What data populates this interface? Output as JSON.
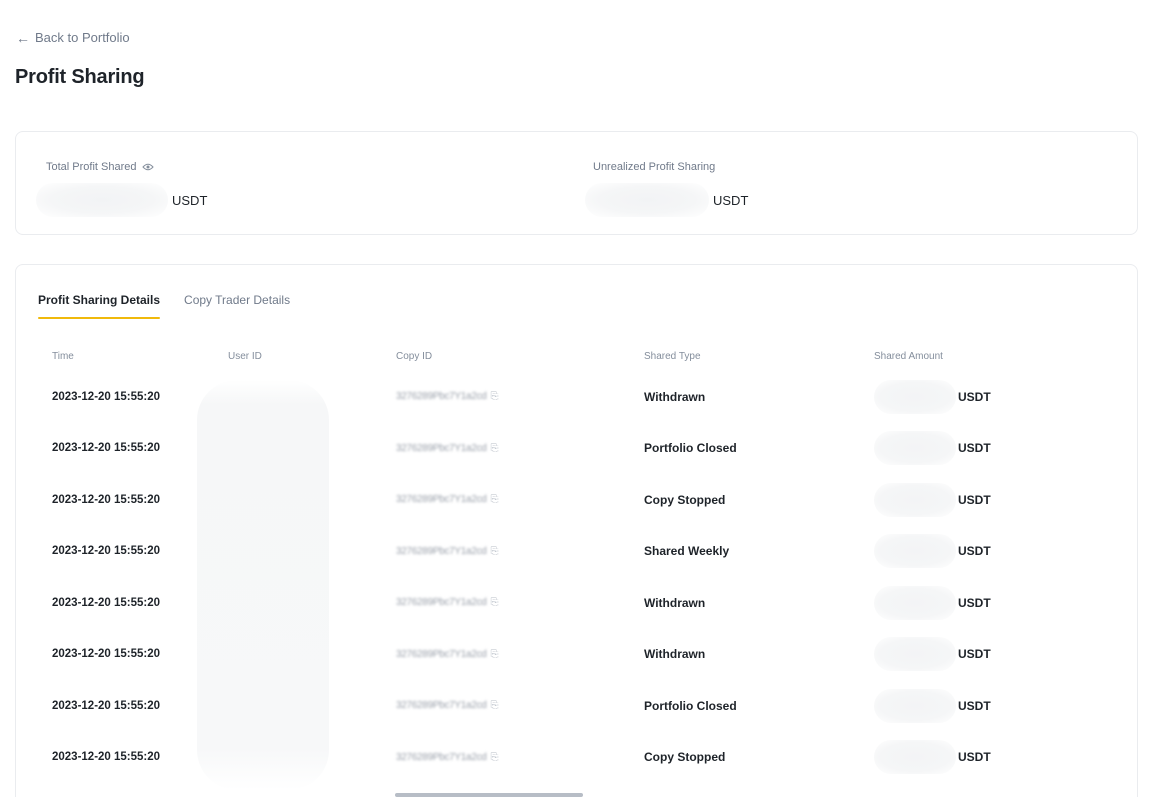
{
  "nav": {
    "back_label": "Back to Portfolio"
  },
  "page": {
    "title": "Profit Sharing"
  },
  "summary": {
    "total_label": "Total Profit Shared",
    "total_unit": "USDT",
    "unrealized_label": "Unrealized Profit Sharing",
    "unrealized_unit": "USDT"
  },
  "tabs": [
    {
      "label": "Profit Sharing Details",
      "active": true
    },
    {
      "label": "Copy Trader Details",
      "active": false
    }
  ],
  "table": {
    "headers": {
      "time": "Time",
      "user_id": "User ID",
      "copy_id": "Copy ID",
      "shared_type": "Shared Type",
      "shared_amount": "Shared Amount"
    },
    "rows": [
      {
        "time": "2023-12-20 15:55:20",
        "copy_id": "3276289Pbc7Y1a2cd",
        "shared_type": "Withdrawn",
        "unit": "USDT"
      },
      {
        "time": "2023-12-20 15:55:20",
        "copy_id": "3276289Pbc7Y1a2cd",
        "shared_type": "Portfolio Closed",
        "unit": "USDT"
      },
      {
        "time": "2023-12-20 15:55:20",
        "copy_id": "3276289Pbc7Y1a2cd",
        "shared_type": "Copy Stopped",
        "unit": "USDT"
      },
      {
        "time": "2023-12-20 15:55:20",
        "copy_id": "3276289Pbc7Y1a2cd",
        "shared_type": "Shared Weekly",
        "unit": "USDT"
      },
      {
        "time": "2023-12-20 15:55:20",
        "copy_id": "3276289Pbc7Y1a2cd",
        "shared_type": "Withdrawn",
        "unit": "USDT"
      },
      {
        "time": "2023-12-20 15:55:20",
        "copy_id": "3276289Pbc7Y1a2cd",
        "shared_type": "Withdrawn",
        "unit": "USDT"
      },
      {
        "time": "2023-12-20 15:55:20",
        "copy_id": "3276289Pbc7Y1a2cd",
        "shared_type": "Portfolio Closed",
        "unit": "USDT"
      },
      {
        "time": "2023-12-20 15:55:20",
        "copy_id": "3276289Pbc7Y1a2cd",
        "shared_type": "Copy Stopped",
        "unit": "USDT"
      }
    ]
  },
  "icons": {
    "back": "arrow-left-icon",
    "eye": "eye-icon",
    "copy": "copy-icon"
  },
  "colors": {
    "accent": "#f0b90b",
    "text": "#1e2329",
    "muted": "#707a8a",
    "border": "#eaecef"
  }
}
